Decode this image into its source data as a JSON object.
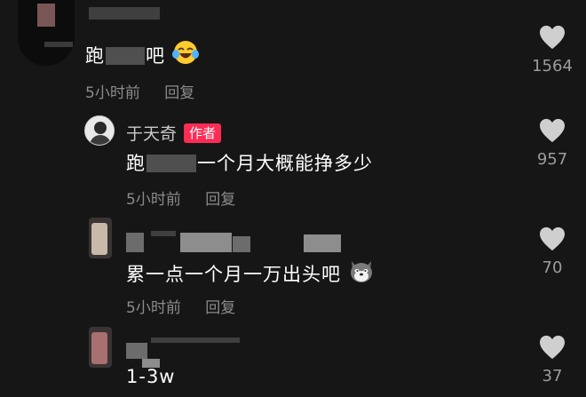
{
  "comments": [
    {
      "text_prefix": "跑",
      "text_suffix": "吧",
      "time": "5小时前",
      "reply_label": "回复",
      "likes": "1564",
      "emoji": "laughing-tears"
    },
    {
      "username": "于天奇",
      "badge": "作者",
      "text_prefix": "跑",
      "text_suffix": "一个月大概能挣多少",
      "time": "5小时前",
      "reply_label": "回复",
      "likes": "957"
    },
    {
      "text": "累一点一个月一万出头吧",
      "time": "5小时前",
      "reply_label": "回复",
      "likes": "70",
      "emoji": "husky-dog"
    },
    {
      "text": "1-3w",
      "likes": "37"
    }
  ],
  "colors": {
    "background": "#161616",
    "badge": "#fd2c55",
    "meta": "#8b8b8b",
    "heart": "#cfcfcf"
  }
}
